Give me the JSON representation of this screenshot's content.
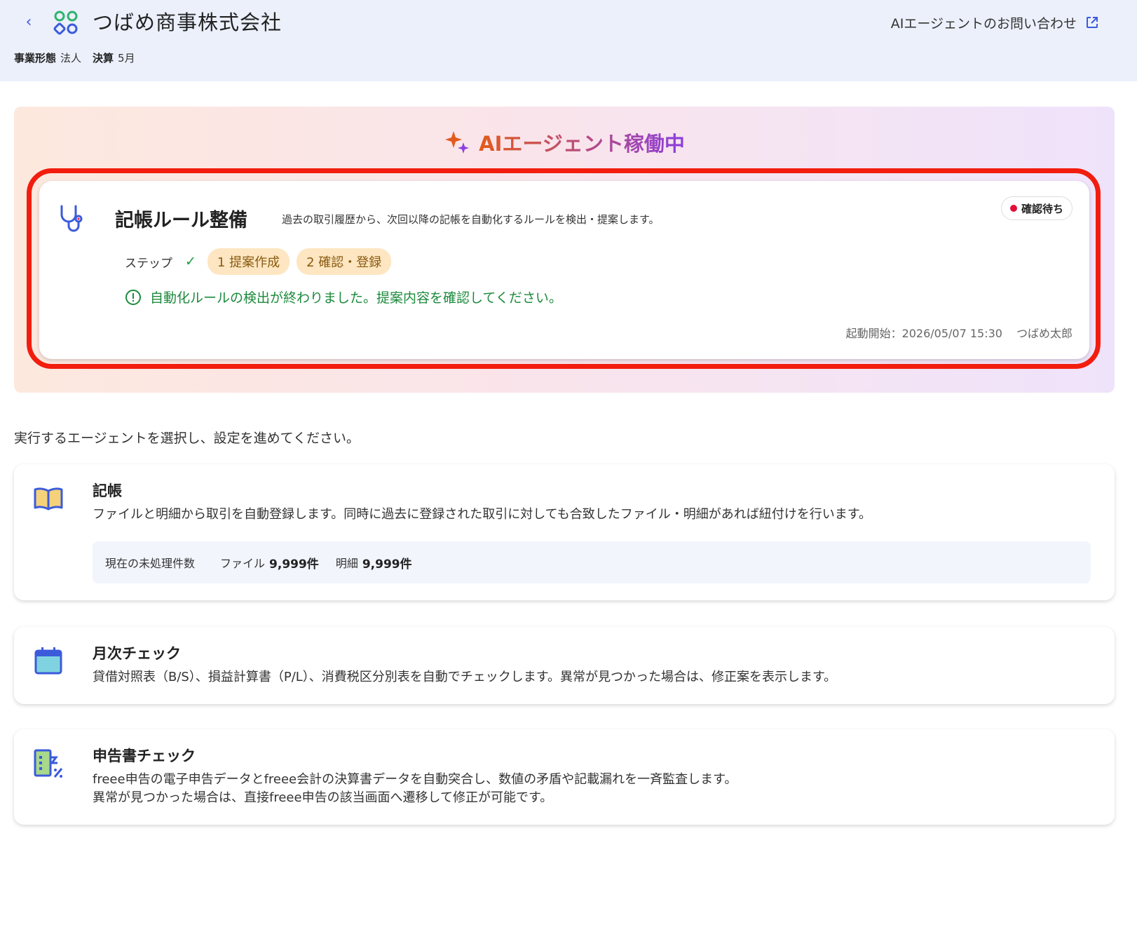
{
  "header": {
    "back_label": "‹",
    "company": "つばめ商事株式会社",
    "contact_label": "AIエージェントのお問い合わせ",
    "meta": [
      {
        "key": "事業形態",
        "value": "法人"
      },
      {
        "key": "決算",
        "value": "5月"
      }
    ]
  },
  "agent_panel": {
    "title": "AIエージェント稼働中",
    "task": {
      "title": "記帳ルール整備",
      "description": "過去の取引履歴から、次回以降の記帳を自動化するルールを検出・提案します。",
      "status": "確認待ち",
      "steps_label": "ステップ",
      "step_check": "✓",
      "steps": [
        "1 提案作成",
        "2 確認・登録"
      ],
      "notice": "自動化ルールの検出が終わりました。提案内容を確認してください。",
      "started": "起動開始：2026/05/07 15:30",
      "user": "つばめ太郎"
    }
  },
  "instruction": "実行するエージェントを選択し、設定を進めてください。",
  "agents": [
    {
      "title": "記帳",
      "description": "ファイルと明細から取引を自動登録します。同時に過去に登録された取引に対しても合致したファイル・明細があれば紐付けを行います。",
      "pending_label": "現在の未処理件数",
      "pending_file_label": "ファイル",
      "pending_file_value": "9,999件",
      "pending_detail_label": "明細",
      "pending_detail_value": "9,999件"
    },
    {
      "title": "月次チェック",
      "description": "貸借対照表（B/S）、損益計算書（P/L）、消費税区分別表を自動でチェックします。異常が見つかった場合は、修正案を表示します。"
    },
    {
      "title": "申告書チェック",
      "description_line1": "freee申告の電子申告データとfreee会計の決算書データを自動突合し、数値の矛盾や記載漏れを一斉監査します。",
      "description_line2": "異常が見つかった場合は、直接freee申告の該当画面へ遷移して修正が可能です。"
    }
  ],
  "colors": {
    "header_bg": "#ebf0fb",
    "accent_blue": "#3b5bdb",
    "highlight_red": "#f21d0e",
    "status_dot": "#e0103a",
    "success_green": "#1c8a3c",
    "step_pill": "#fde6c1"
  },
  "icons": [
    "back-chevron-icon",
    "company-logo-icon",
    "external-link-icon",
    "sparkle-icon",
    "stethoscope-icon",
    "info-circle-icon",
    "book-icon",
    "calendar-icon",
    "document-percent-icon"
  ]
}
